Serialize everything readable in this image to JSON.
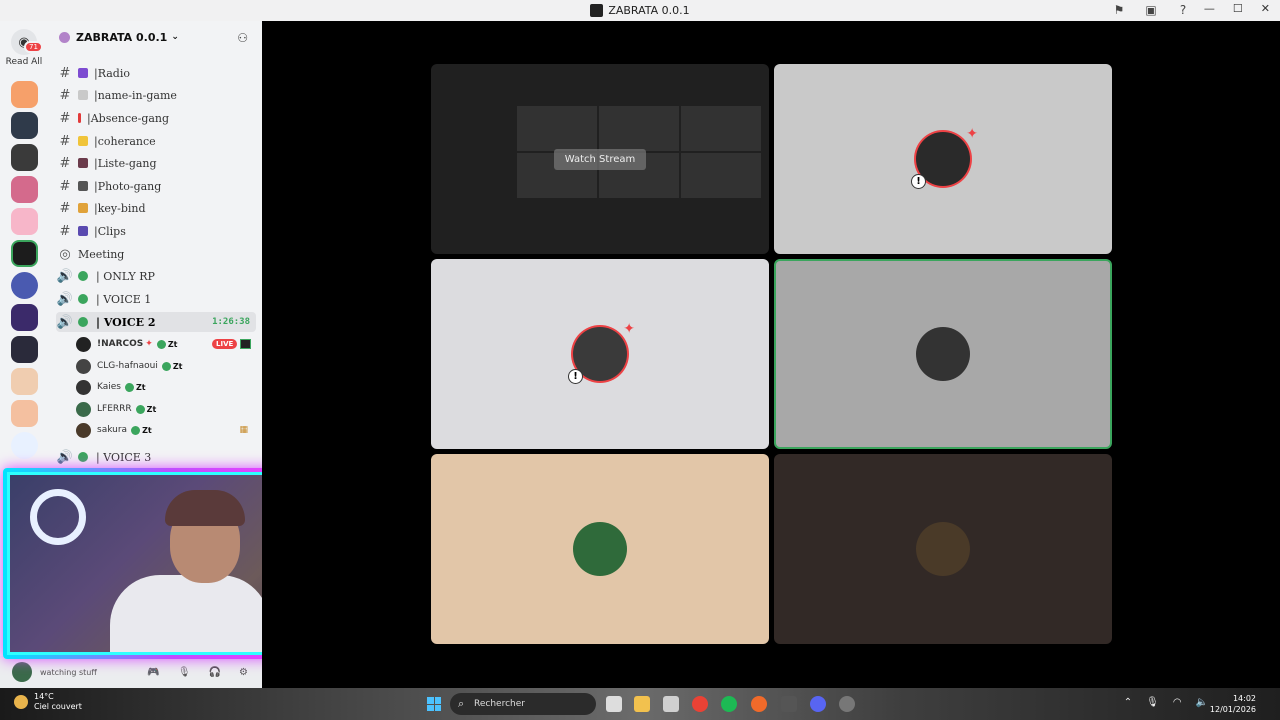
{
  "window": {
    "title": "ZABRATA 0.0.1"
  },
  "rail": {
    "badge": "71",
    "read_all": "Read All"
  },
  "server": {
    "name": "ZABRATA 0.0.1"
  },
  "channels": [
    {
      "prefix": "| ",
      "name": "Radio",
      "emoji_color": "#7d4bd1"
    },
    {
      "prefix": "| ",
      "name": "name-in-game",
      "emoji_color": "#c9c9c9"
    },
    {
      "prefix": "| ",
      "name": "Absence-gang",
      "emoji_color": "#e23a3a"
    },
    {
      "prefix": "| ",
      "name": "coherance",
      "emoji_color": "#f0c43a"
    },
    {
      "prefix": "| ",
      "name": "Liste-gang",
      "emoji_color": "#6b3b4b"
    },
    {
      "prefix": "| ",
      "name": "Photo-gang",
      "emoji_color": "#555555"
    },
    {
      "prefix": "| ",
      "name": "key-bind",
      "emoji_color": "#e0a23a"
    },
    {
      "prefix": "| ",
      "name": "Clips",
      "emoji_color": "#5a4ab0"
    }
  ],
  "voice_channels": {
    "meeting": "Meeting",
    "only_rp": "| ONLY RP",
    "voice1": "| VOICE 1",
    "voice2": "| VOICE 2",
    "voice2_timer": "1:26:38",
    "voice3": "| VOICE 3"
  },
  "members": [
    {
      "name": "!NARCOS",
      "tag": "Zt",
      "live": "LIVE"
    },
    {
      "name": "CLG-hafnaoui",
      "tag": "Zt"
    },
    {
      "name": "Kaies",
      "tag": "Zt"
    },
    {
      "name": "LFERRR",
      "tag": "Zt"
    },
    {
      "name": "sakura",
      "tag": "Zt"
    }
  ],
  "userbar": {
    "status": "watching stuff"
  },
  "stage": {
    "watch_stream": "Watch Stream"
  },
  "taskbar": {
    "temp": "14°C",
    "weather": "Ciel couvert",
    "search_placeholder": "Rechercher",
    "time": "14:02",
    "date": "12/01/2026"
  },
  "colors": {
    "voice_green": "#3ba55d",
    "live_red": "#ed4245",
    "webcam_glow": "#d64bff"
  }
}
